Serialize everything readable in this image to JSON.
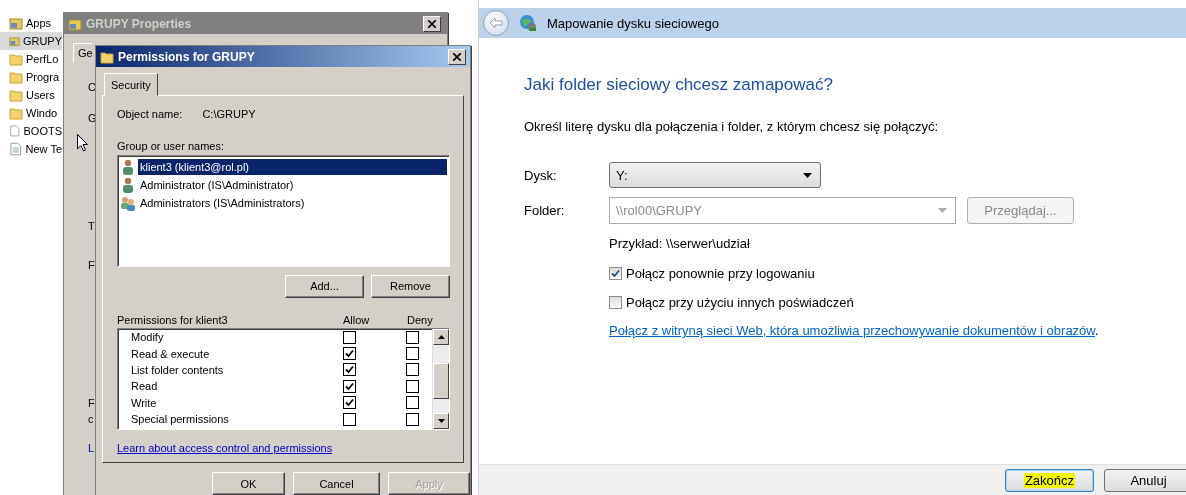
{
  "explorer": {
    "items": [
      {
        "label": "Apps",
        "kind": "share",
        "selected": false
      },
      {
        "label": "GRUPY",
        "kind": "share",
        "selected": true
      },
      {
        "label": "PerfLo",
        "kind": "folder",
        "selected": false
      },
      {
        "label": "Progra",
        "kind": "folder",
        "selected": false
      },
      {
        "label": "Users",
        "kind": "folder",
        "selected": false
      },
      {
        "label": "Windo",
        "kind": "folder",
        "selected": false
      },
      {
        "label": "BOOTS",
        "kind": "file",
        "selected": false
      },
      {
        "label": "New Te",
        "kind": "text",
        "selected": false
      }
    ]
  },
  "properties_window": {
    "title": "GRUPY Properties",
    "tab": "Ge",
    "fragments": [
      "C",
      "G",
      "T",
      "F",
      "F",
      "c",
      "L"
    ]
  },
  "permissions_window": {
    "title": "Permissions for GRUPY",
    "tabs": [
      {
        "label": "Security",
        "selected": true
      }
    ],
    "object_name_label": "Object name:",
    "object_name": "C:\\GRUPY",
    "users_label": "Group or user names:",
    "users": [
      {
        "name": "klient3 (klient3@rol.pl)",
        "kind": "user",
        "selected": true
      },
      {
        "name": "Administrator (IS\\Administrator)",
        "kind": "user",
        "selected": false
      },
      {
        "name": "Administrators (IS\\Administrators)",
        "kind": "group",
        "selected": false
      }
    ],
    "user_buttons": [
      "Add...",
      "Remove"
    ],
    "permissions_label": "Permissions for klient3",
    "allow_header": "Allow",
    "deny_header": "Deny",
    "permissions": [
      {
        "name": "Modify",
        "allow": false,
        "deny": false
      },
      {
        "name": "Read & execute",
        "allow": true,
        "deny": false
      },
      {
        "name": "List folder contents",
        "allow": true,
        "deny": false
      },
      {
        "name": "Read",
        "allow": true,
        "deny": false
      },
      {
        "name": "Write",
        "allow": true,
        "deny": false
      },
      {
        "name": "Special permissions",
        "allow": false,
        "deny": false
      }
    ],
    "link": "Learn about access control and permissions",
    "buttons": [
      {
        "label": "OK",
        "disabled": false
      },
      {
        "label": "Cancel",
        "disabled": false
      },
      {
        "label": "Apply",
        "disabled": true
      }
    ]
  },
  "wizard": {
    "title": "Mapowanie dysku sieciowego",
    "heading": "Jaki folder sieciowy chcesz zamapować?",
    "instruction": "Określ literę dysku dla połączenia i folder, z którym chcesz się połączyć:",
    "drive": {
      "label": "Dysk:",
      "value": "Y:"
    },
    "folder": {
      "label": "Folder:",
      "value": "\\\\rol00\\GRUPY",
      "disabled": true
    },
    "browse": {
      "label": "Przeglądaj...",
      "disabled": true
    },
    "example": "Przykład: \\\\serwer\\udział",
    "options": [
      {
        "label": "Połącz ponownie przy logowaniu",
        "checked": true
      },
      {
        "label": "Połącz przy użyciu innych poświadczeń",
        "checked": false
      }
    ],
    "link": "Połącz z witryną sieci Web, która umożliwia przechowywanie dokumentów i obrazów",
    "link_suffix": ".",
    "buttons": [
      {
        "label": "Zakończ",
        "highlighted": true
      },
      {
        "label": "Anuluj",
        "highlighted": false
      }
    ]
  }
}
